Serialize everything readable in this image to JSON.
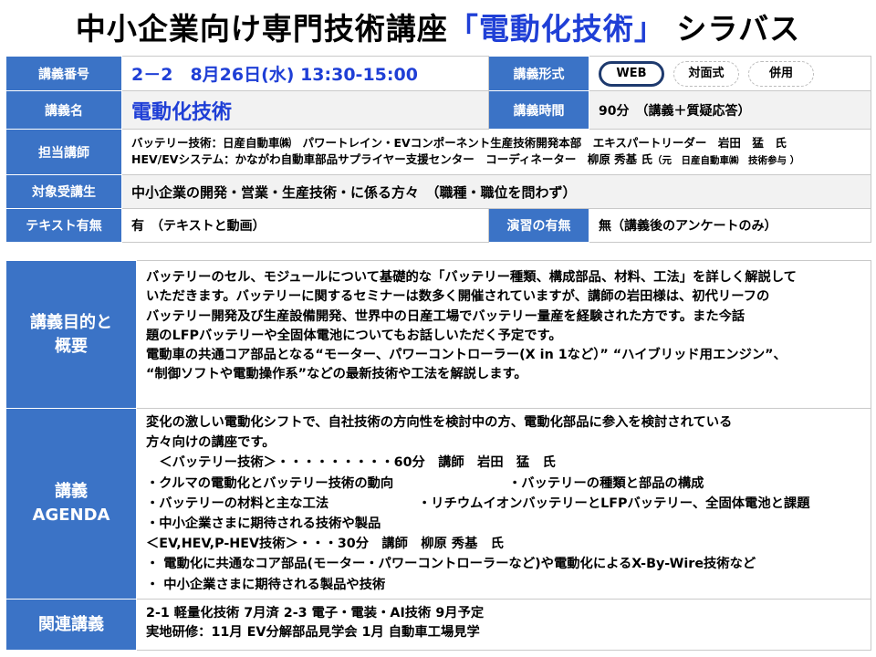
{
  "title": {
    "prefix": "中小企業向け専門技術講座",
    "highlight": "「電動化技術」",
    "suffix": " シラバス"
  },
  "info": {
    "lecture_number_label": "講義番号",
    "lecture_number_value": "2－2　8月26日(水) 13:30-15:00",
    "format_label": "講義形式",
    "format_options": [
      "WEB",
      "対面式",
      "併用"
    ],
    "format_selected": "WEB",
    "lecture_name_label": "講義名",
    "lecture_name_value": "電動化技術",
    "duration_label": "講義時間",
    "duration_value": "90分　（講義＋質疑応答）",
    "instructor_label": "担当講師",
    "instructor_line1": "バッテリー技術：日産自動車㈱　パワートレイン・EVコンポーネント生産技術開発本部　エキスパートリーダー　岩田　猛　氏",
    "instructor_line2_main": "HEV/EVシステム：かながわ自動車部品サプライヤー支援センター　コーディネーター　柳原 秀基 氏",
    "instructor_line2_note": "（元　日産自動車㈱　技術参与 ）",
    "audience_label": "対象受講生",
    "audience_value": "中小企業の開発・営業・生産技術・に係る方々　（職種・職位を問わず）",
    "text_label": "テキスト有無",
    "text_value": "有　（テキストと動画）",
    "exercise_label": "演習の有無",
    "exercise_value": "無（講義後のアンケートのみ）"
  },
  "purpose": {
    "label_line1": "講義目的と",
    "label_line2": "概要",
    "lines": [
      "バッテリーのセル、モジュールについて基礎的な「バッテリー種類、構成部品、材料、工法」を詳しく解説して",
      "いただきます。バッテリーに関するセミナーは数多く開催されていますが、講師の岩田様は、初代リーフの",
      "バッテリー開発及び生産設備開発、世界中の日産工場でバッテリー量産を経験された方です。また今話",
      "題のLFPバッテリーや全固体電池についてもお話しいただく予定です。",
      "電動車の共通コア部品となる“モーター、パワーコントローラー(X in 1など）” “ハイブリッド用エンジン”、",
      "“制御ソフトや電動操作系”などの最新技術や工法を解説します。"
    ]
  },
  "agenda": {
    "label_line1": "講義",
    "label_line2": "AGENDA",
    "intro_line1": "変化の激しい電動化シフトで、自社技術の方向性を検討中の方、電動化部品に参入を検討されている",
    "intro_line2": "方々向けの講座です。",
    "battery_header": "　＜バッテリー技術＞・・・・・・・・・60分　講師　岩田　猛　氏",
    "row1_left": "・クルマの電動化とバッテリー技術の動向",
    "row1_right": "・バッテリーの種類と部品の構成",
    "row2_left": "・バッテリーの材料と主な工法",
    "row2_right": "・リチウムイオンバッテリーとLFPバッテリー、全固体電池と課題",
    "item_sme_tech": "・中小企業さまに期待される技術や製品",
    "ev_header": "＜EV,HEV,P-HEV技術＞・・・30分　講師　柳原 秀基　氏",
    "item_core": "・ 電動化に共通なコア部品(モーター・パワーコントローラーなど)や電動化によるX-By-Wire技術など",
    "item_sme_products": "・ 中小企業さまに期待される製品や技術"
  },
  "related": {
    "label": "関連講義",
    "line1": "2-1 軽量化技術 7月済  2-3  電子・電装・AI技術  9月予定",
    "line2": "実地研修：11月  EV分解部品見学会  1月  自動車工場見学"
  },
  "colors": {
    "label_bg": "#3b73c6",
    "accent_blue": "#1f3fd6",
    "selected_ring": "#1e3a6e"
  }
}
